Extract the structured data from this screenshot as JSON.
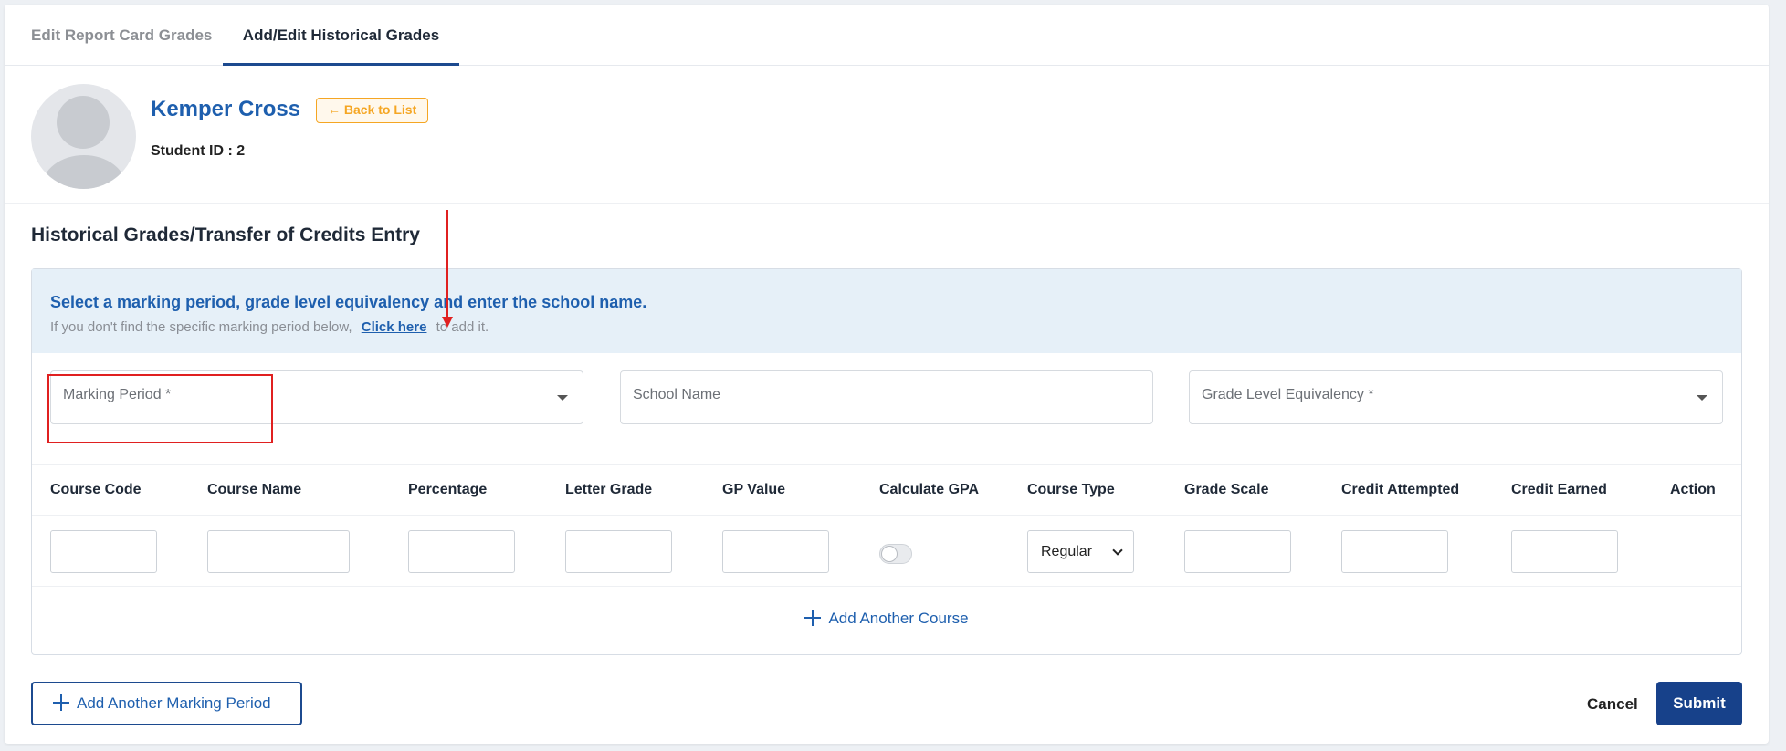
{
  "tabs": [
    {
      "label": "Edit Report Card Grades"
    },
    {
      "label": "Add/Edit Historical Grades"
    }
  ],
  "student": {
    "name": "Kemper Cross",
    "back_label": "Back to List",
    "id_label": "Student ID : 2"
  },
  "section_title": "Historical Grades/Transfer of Credits Entry",
  "info": {
    "main": "Select a marking period, grade level equivalency and enter the school name.",
    "sub_before": "If you don't find the specific marking period below,",
    "link": "Click here",
    "sub_after": "to add it."
  },
  "fields": {
    "marking_period": "Marking Period *",
    "school_name": "School Name",
    "grade_level": "Grade Level Equivalency *"
  },
  "table": {
    "headers": [
      "Course Code",
      "Course Name",
      "Percentage",
      "Letter Grade",
      "GP Value",
      "Calculate GPA",
      "Course Type",
      "Grade Scale",
      "Credit Attempted",
      "Credit Earned",
      "Action"
    ],
    "course_type_value": "Regular",
    "calculate_gpa_on": false
  },
  "add_course_label": "Add Another Course",
  "add_marking_period_label": "Add Another Marking Period",
  "cancel_label": "Cancel",
  "submit_label": "Submit",
  "colors": {
    "primary": "#1c4a8f",
    "link": "#1e5fae",
    "accent": "#f5a623",
    "info_bg": "#e6f0f8",
    "annotation": "#e02020"
  }
}
